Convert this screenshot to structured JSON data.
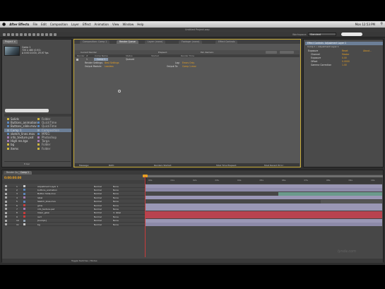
{
  "menubar": {
    "app_name": "After Effects",
    "items": [
      "File",
      "Edit",
      "Composition",
      "Layer",
      "Effect",
      "Animation",
      "View",
      "Window",
      "Help"
    ],
    "clock": "Mon 12:53 PM",
    "spotlight_icon": "search-icon"
  },
  "window": {
    "title": "Untitled Project.aep"
  },
  "toolbar": {
    "workspace_label": "Workspace:",
    "workspace_value": "Standard"
  },
  "project": {
    "tab": "Project ×",
    "thumb_name": "Comp 1",
    "thumb_meta": [
      "720 x 480 (0.91)",
      "Δ 0:00:10:00, 29.97 fps"
    ],
    "items": [
      {
        "name": "Solids",
        "type": "Folder",
        "color": "#c9b13d",
        "selected": false
      },
      {
        "name": "Buttons_animation.mov",
        "type": "QuickTime",
        "color": "#5d86b8",
        "selected": false
      },
      {
        "name": "Buttons_slide.mov",
        "type": "QuickTime",
        "color": "#5d86b8",
        "selected": false
      },
      {
        "name": "Comp 1",
        "type": "Composition",
        "color": "#8fa0b0",
        "selected": true
      },
      {
        "name": "sketch_lines.mov",
        "type": "MPEG",
        "color": "#5d86b8",
        "selected": false
      },
      {
        "name": "info_texture.psd",
        "type": "Photoshop",
        "color": "#a07ab0",
        "selected": false
      },
      {
        "name": "High res.tga",
        "type": "Targa",
        "color": "#a07ab0",
        "selected": false
      },
      {
        "name": "bg",
        "type": "Folder",
        "color": "#c9b13d",
        "selected": false
      },
      {
        "name": "items",
        "type": "Folder",
        "color": "#c9b13d",
        "selected": false
      }
    ],
    "footer_label": "8 bpc"
  },
  "center": {
    "tabs": [
      "Composition: Comp 1",
      "Render Queue",
      "Layer: (none)",
      "Footage: (none)",
      "Effect Controls"
    ],
    "active_tab": 1,
    "toolbar_items": [
      "Current Render",
      "Elapsed:",
      "Est. Remain:"
    ],
    "columns": [
      "Render",
      "#",
      "Comp Name",
      "Status",
      "Started",
      "Render Time"
    ],
    "rows": [
      {
        "num": "1",
        "name": "Comp 1",
        "status": "Queued",
        "orange": false
      },
      {
        "label": "Render Settings:",
        "value": "Best Settings",
        "extra_label": "Log:",
        "extra_value": "Errors Only",
        "orange": true
      },
      {
        "label": "Output Module:",
        "value": "Lossless",
        "extra_label": "Output To:",
        "extra_value": "Comp 1.mov",
        "orange": true
      }
    ],
    "bottom": [
      "Message:",
      "RAM:",
      "Renders Started:",
      "Total Time Elapsed:",
      "Most Recent Error:"
    ]
  },
  "right": {
    "title": "Effect Controls: Adjustment Layer 1",
    "sub": "Comp 1 • Adjustment Layer 1",
    "props": [
      {
        "name": "Exposure",
        "value": "Reset",
        "extra": "About..."
      },
      {
        "name": "Channel",
        "value": "Master"
      },
      {
        "name": "Exposure",
        "value": "0.00"
      },
      {
        "name": "Offset",
        "value": "0.0000"
      },
      {
        "name": "Gamma Correction",
        "value": "1.00"
      }
    ]
  },
  "timeline": {
    "tabs": [
      "Render Queue",
      "Comp 1"
    ],
    "active_tab": 1,
    "timecode": "0:00:00:00",
    "ruler": [
      "00s",
      "01s",
      "02s",
      "03s",
      "04s",
      "05s",
      "06s",
      "07s",
      "08s",
      "09s",
      "10s"
    ],
    "layers": [
      {
        "num": "1",
        "name": "Adjustment Layer 1",
        "color": "#c9c9c9",
        "mode": "Normal",
        "parent": "None",
        "bar": "#9a97b5"
      },
      {
        "num": "2",
        "name": "buttons_animation",
        "color": "#5d86b8",
        "mode": "Normal",
        "parent": "None",
        "bar": "#8d8aa9"
      },
      {
        "num": "3",
        "name": "Button Slide.mov",
        "color": "#5d86b8",
        "mode": "Normal",
        "parent": "None",
        "bar": "#6b9a8c"
      },
      {
        "num": "4",
        "name": "label",
        "color": "#a07ab0",
        "mode": "Normal",
        "parent": "None",
        "bar": "#9a97b5"
      },
      {
        "num": "5",
        "name": "Sketch_lines.mov",
        "color": "#5d86b8",
        "mode": "Normal",
        "parent": "None",
        "bar": "#555"
      },
      {
        "num": "6",
        "name": "glow",
        "color": "#c93c3c",
        "mode": "Normal",
        "parent": "None",
        "bar": "#9a97b5"
      },
      {
        "num": "7",
        "name": "info_texture.psd",
        "color": "#a07ab0",
        "mode": "Normal",
        "parent": "None",
        "bar": "#9a97b5"
      },
      {
        "num": "8",
        "name": "lower_glow",
        "color": "#c93c3c",
        "mode": "Normal",
        "parent": "4. label",
        "bar": "#b8434f"
      },
      {
        "num": "9",
        "name": "rect",
        "color": "#c93c3c",
        "mode": "Normal",
        "parent": "None",
        "bar": "#b8434f"
      },
      {
        "num": "10",
        "name": "[Comp1]",
        "color": "#8fa0b0",
        "mode": "Normal",
        "parent": "None",
        "bar": "#9a97b5"
      },
      {
        "num": "11",
        "name": "bg",
        "color": "#c9c9c9",
        "mode": "Normal",
        "parent": "None",
        "bar": "#8d8aa9"
      }
    ],
    "footer": "Toggle Switches / Modes"
  },
  "watermark": "lynda.com"
}
